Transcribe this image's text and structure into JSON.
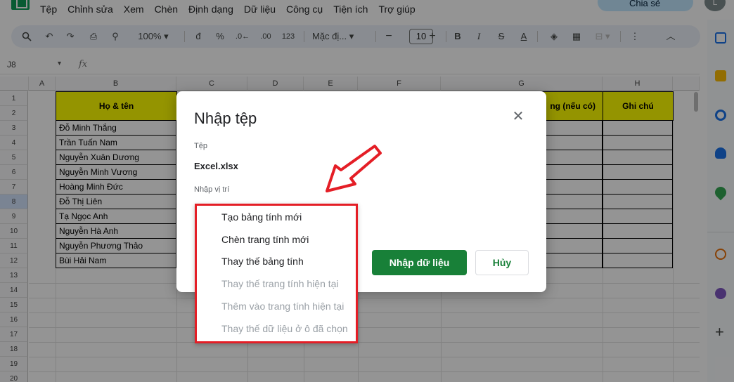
{
  "menu": {
    "items": [
      "Tệp",
      "Chỉnh sửa",
      "Xem",
      "Chèn",
      "Định dạng",
      "Dữ liệu",
      "Công cụ",
      "Tiện ích",
      "Trợ giúp"
    ]
  },
  "header_right": {
    "share_label": "Chia sẻ",
    "avatar_letter": "L"
  },
  "toolbar": {
    "zoom": "100%",
    "currency": "đ",
    "percent": "%",
    "dec_decrease": ".0←",
    "dec_increase": ".00",
    "number_format": "123",
    "font": "Mặc đị...",
    "font_size": "10",
    "bold": "B",
    "italic": "I",
    "strike": "S",
    "text_color": "A"
  },
  "formula_bar": {
    "cell_ref": "J8",
    "fx": "fx"
  },
  "grid": {
    "columns": [
      "A",
      "B",
      "C",
      "D",
      "E",
      "F",
      "G",
      "H"
    ],
    "rows": [
      "1",
      "2",
      "3",
      "4",
      "5",
      "6",
      "7",
      "8",
      "9",
      "10",
      "11",
      "12",
      "13",
      "14",
      "15",
      "16",
      "17",
      "18",
      "19",
      "20"
    ],
    "header_name": "Họ & tên",
    "header_g": "ng (nếu có)",
    "header_h": "Ghi chú",
    "names": [
      "Đỗ Minh Thắng",
      "Trần Tuấn Nam",
      "Nguyễn Xuân Dương",
      "Nguyễn Minh Vương",
      "Hoàng Minh Đức",
      "Đỗ Thị Liên",
      "Tạ Ngọc Anh",
      "Nguyễn Hà Anh",
      "Nguyễn Phương Thảo",
      "Bùi Hải Nam"
    ]
  },
  "dialog": {
    "title": "Nhập tệp",
    "file_label": "Tệp",
    "file_name": "Excel.xlsx",
    "location_label": "Nhập vị trí",
    "import_button": "Nhập dữ liệu",
    "cancel_button": "Hủy",
    "options": [
      {
        "label": "Tạo bảng tính mới",
        "enabled": true
      },
      {
        "label": "Chèn trang tính mới",
        "enabled": true
      },
      {
        "label": "Thay thế bảng tính",
        "enabled": true
      },
      {
        "label": "Thay thế trang tính hiện tại",
        "enabled": false
      },
      {
        "label": "Thêm vào trang tính hiện tại",
        "enabled": false
      },
      {
        "label": "Thay thế dữ liệu ở ô đã chọn",
        "enabled": false
      }
    ]
  },
  "colors": {
    "highlight": "#e41e26",
    "primary_green": "#188038",
    "header_yellow": "#ffff00"
  }
}
